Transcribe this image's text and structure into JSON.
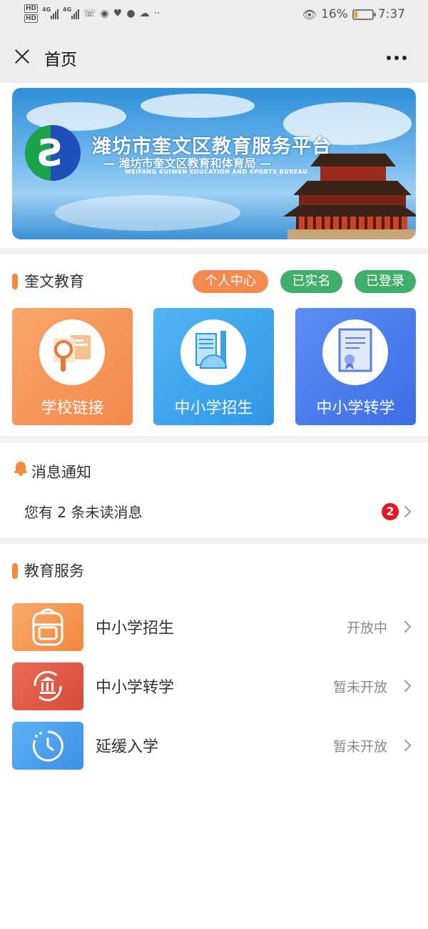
{
  "status_bar": {
    "hd1": "HD",
    "hd2": "HD",
    "net1": "4G",
    "net2": "4G",
    "battery": "16%",
    "battery_level": 0.16,
    "time": "7:37"
  },
  "nav": {
    "title": "首页"
  },
  "banner": {
    "title": "潍坊市奎文区教育服务平台",
    "subtitle": "— 潍坊市奎文区教育和体育局 —",
    "english": "WEIFANG KUIWEN EDUCATION AND SPORTS BUREAU"
  },
  "section_main": {
    "title": "奎文教育",
    "tags": [
      {
        "label": "个人中心",
        "color": "#f38b50"
      },
      {
        "label": "已实名",
        "color": "#3fae6a"
      },
      {
        "label": "已登录",
        "color": "#3fae6a"
      }
    ],
    "cards": [
      {
        "label": "学校链接",
        "icon": "school-link-icon"
      },
      {
        "label": "中小学招生",
        "icon": "ruler-book-icon"
      },
      {
        "label": "中小学转学",
        "icon": "certificate-icon"
      }
    ]
  },
  "notice": {
    "title": "消息通知",
    "message": "您有 2 条未读消息",
    "unread_count": "2"
  },
  "services": {
    "title": "教育服务",
    "items": [
      {
        "name": "中小学招生",
        "status": "开放中",
        "icon": "backpack-icon"
      },
      {
        "name": "中小学转学",
        "status": "暂未开放",
        "icon": "transfer-building-icon"
      },
      {
        "name": "延缓入学",
        "status": "暂未开放",
        "icon": "clock-icon"
      }
    ]
  },
  "colors": {
    "accent": "#f38b3a",
    "green_tag": "#3fae6a",
    "badge_red": "#e8141e"
  }
}
